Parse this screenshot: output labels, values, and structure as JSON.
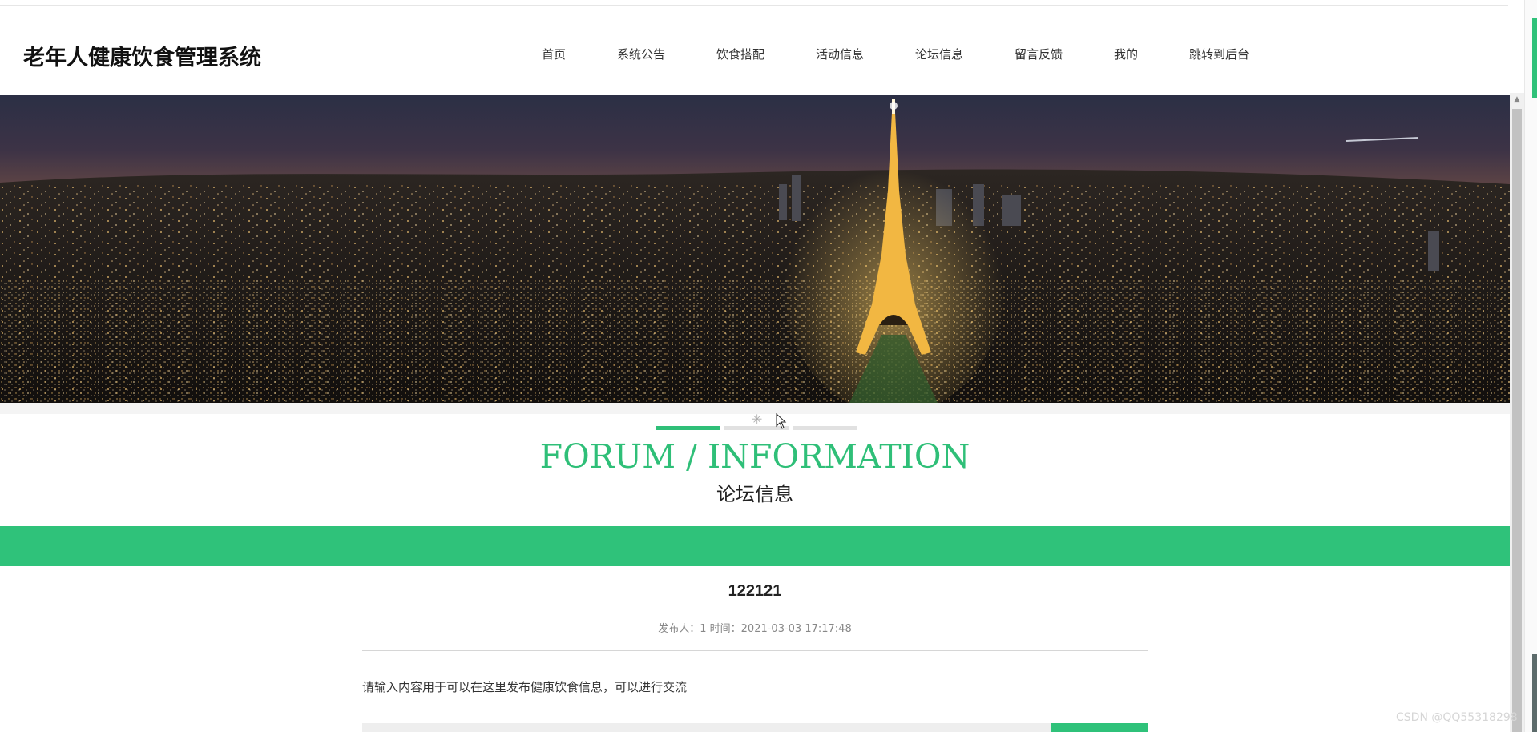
{
  "header": {
    "logo": "老年人健康饮食管理系统",
    "nav": [
      {
        "label": "首页"
      },
      {
        "label": "系统公告"
      },
      {
        "label": "饮食搭配"
      },
      {
        "label": "活动信息"
      },
      {
        "label": "论坛信息"
      },
      {
        "label": "留言反馈"
      },
      {
        "label": "我的"
      },
      {
        "label": "跳转到后台"
      }
    ]
  },
  "banner": {
    "slide_count": 3,
    "active_slide": 1
  },
  "section": {
    "title_en": "FORUM / INFORMATION",
    "title_cn": "论坛信息"
  },
  "post": {
    "title": "122121",
    "meta": "发布人：1 时间：2021-03-03 17:17:48",
    "content": "请输入内容用于可以在这里发布健康饮食信息，可以进行交流"
  },
  "watermark": "CSDN @QQ55318298",
  "colors": {
    "accent": "#2fc27a",
    "title_en": "#2fbf78"
  }
}
